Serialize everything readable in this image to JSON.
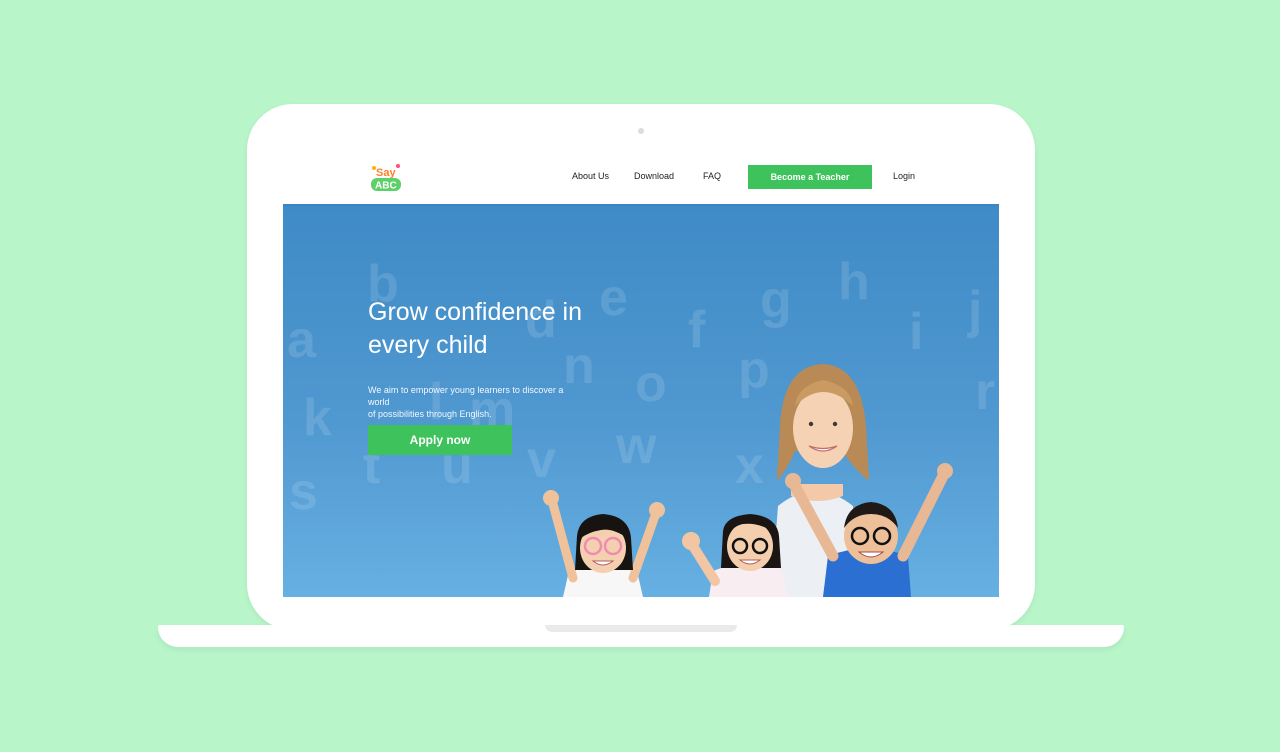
{
  "nav": {
    "logo_text_top": "Say",
    "logo_text_bottom": "ABC",
    "about": "About Us",
    "download": "Download",
    "faq": "FAQ",
    "become_teacher": "Become a Teacher",
    "login": "Login"
  },
  "hero": {
    "title_line1": "Grow confidence in",
    "title_line2": "every child",
    "subtitle_line1": "We aim to empower young learners to discover a world",
    "subtitle_line2": "of possibilities through English.",
    "cta": "Apply now",
    "background_letters": [
      "a",
      "b",
      "d",
      "e",
      "f",
      "g",
      "h",
      "i",
      "j",
      "k",
      "l",
      "m",
      "n",
      "o",
      "p",
      "r",
      "s",
      "t",
      "u",
      "v",
      "w",
      "x"
    ]
  },
  "colors": {
    "background": "#b8f5c9",
    "accent_green": "#3ec35c",
    "hero_blue": "#4a92cc"
  }
}
